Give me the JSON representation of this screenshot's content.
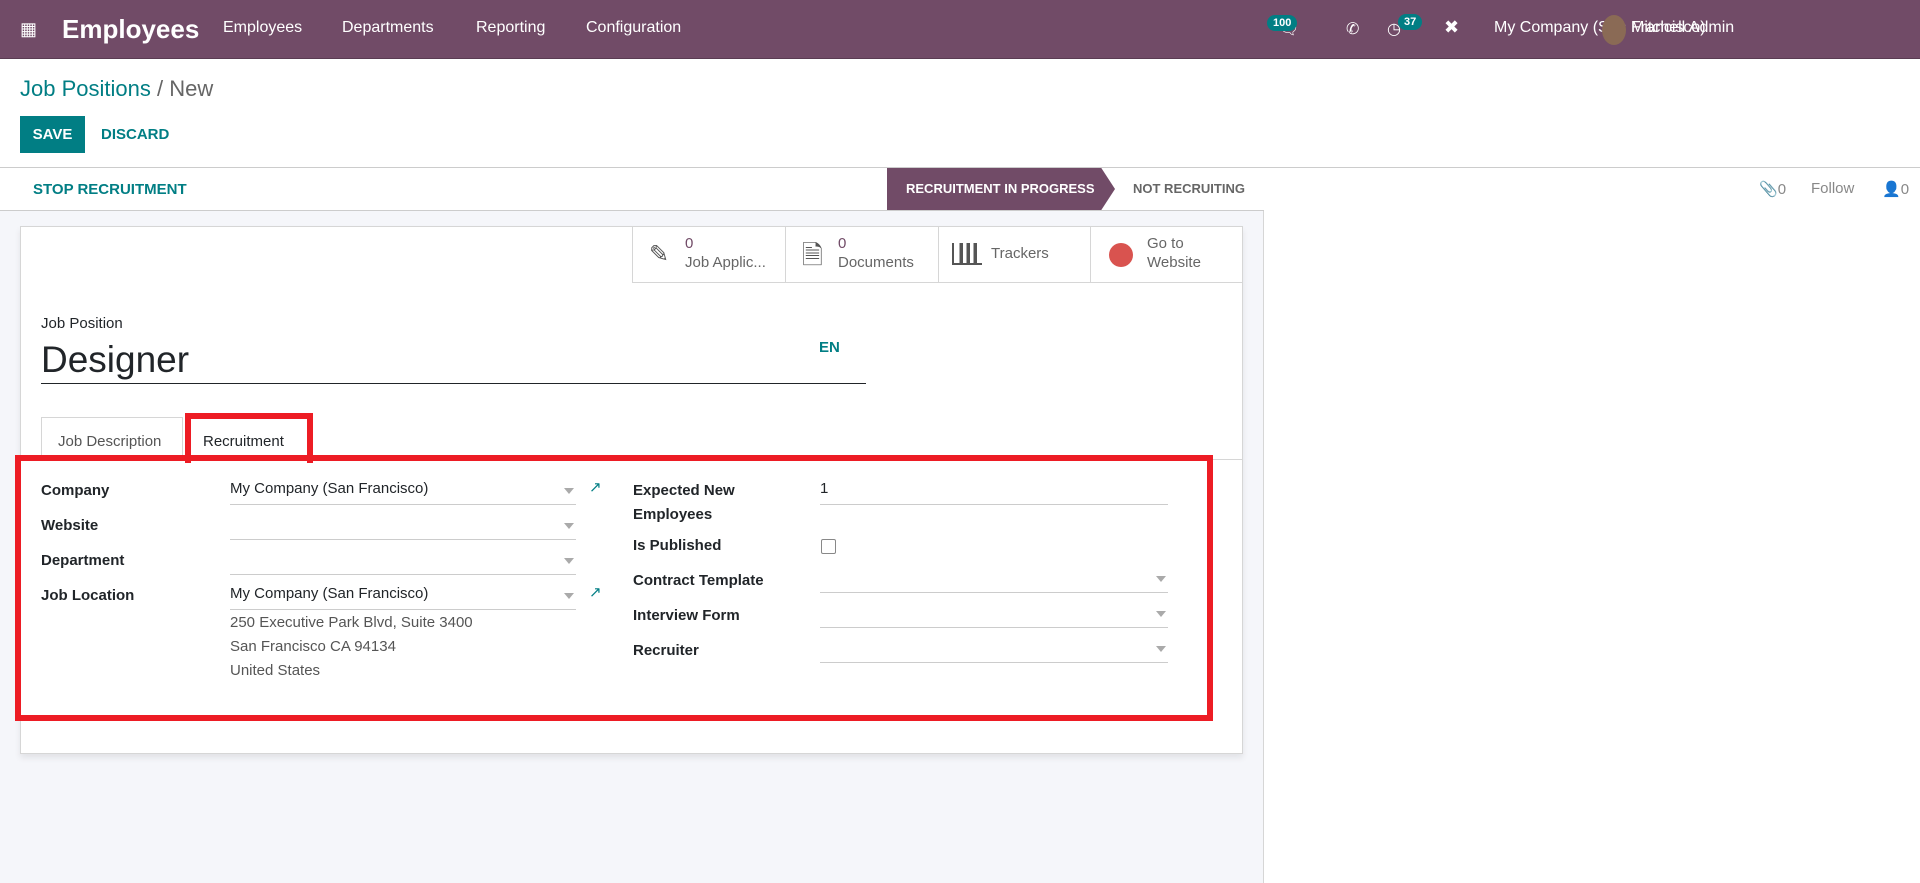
{
  "navbar": {
    "app_title": "Employees",
    "menu": [
      "Employees",
      "Departments",
      "Reporting",
      "Configuration"
    ],
    "messages_count": "100",
    "activities_count": "37",
    "company": "My Company (San Francisco)",
    "user": "Mitchell Admin",
    "color": "#714b67"
  },
  "breadcrumb": {
    "parent": "Job Positions",
    "current": "New"
  },
  "actions": {
    "save": "SAVE",
    "discard": "DISCARD"
  },
  "statusbar": {
    "stop": "STOP RECRUITMENT",
    "stages": [
      "RECRUITMENT IN PROGRESS",
      "NOT RECRUITING"
    ],
    "active": "RECRUITMENT IN PROGRESS"
  },
  "chatter": {
    "attachments": "0",
    "follow": "Follow",
    "followers": "0"
  },
  "smart_buttons": [
    {
      "count": "0",
      "label": "Job Applic...",
      "icon": "pencil-icon"
    },
    {
      "count": "0",
      "label": "Documents",
      "icon": "document-icon"
    },
    {
      "label": "Trackers",
      "icon": "bar-chart-icon"
    },
    {
      "label1": "Go to",
      "label2": "Website",
      "icon": "globe-icon"
    }
  ],
  "form": {
    "name_label": "Job Position",
    "name": "Designer",
    "lang": "EN",
    "tabs": [
      "Job Description",
      "Recruitment"
    ],
    "active_tab": "Recruitment",
    "left": {
      "company_label": "Company",
      "company": "My Company (San Francisco)",
      "website_label": "Website",
      "website": "",
      "department_label": "Department",
      "department": "",
      "location_label": "Job Location",
      "location": "My Company (San Francisco)",
      "address": [
        "250 Executive Park Blvd, Suite 3400",
        "San Francisco CA 94134",
        "United States"
      ]
    },
    "right": {
      "expected_label1": "Expected New",
      "expected_label2": "Employees",
      "expected": "1",
      "published_label": "Is Published",
      "published": false,
      "contract_label": "Contract Template",
      "interview_label": "Interview Form",
      "recruiter_label": "Recruiter"
    }
  },
  "highlight_color": "#ed1c24"
}
